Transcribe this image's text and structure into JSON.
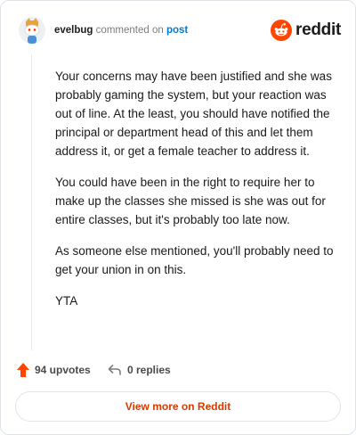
{
  "header": {
    "author": "evelbug",
    "verb": "commented on",
    "post_link": "post",
    "brand": "reddit"
  },
  "comment": {
    "paragraphs": [
      "Your concerns may have been justified and she was probably gaming the system, but your reaction was out of line. At the least, you should have notified the principal or department head of this and let them address it, or get a female teacher to address it.",
      "You could have been in the right to require her to make up the classes she missed is she was out for entire classes, but it's probably too late now.",
      "As someone else mentioned, you'll probably need to get your union in on this.",
      "YTA"
    ]
  },
  "actions": {
    "upvotes": "94 upvotes",
    "replies": "0 replies"
  },
  "footer": {
    "view_more": "View more on Reddit"
  },
  "colors": {
    "brand": "#ff4500",
    "link": "#0079d3",
    "view_more": "#d93a00",
    "upvote_arrow": "#ff4500"
  },
  "icons": {
    "avatar": "snoo-avatar",
    "brand": "reddit-logo-icon",
    "upvote": "upvote-arrow-icon",
    "reply": "reply-arrow-icon"
  }
}
